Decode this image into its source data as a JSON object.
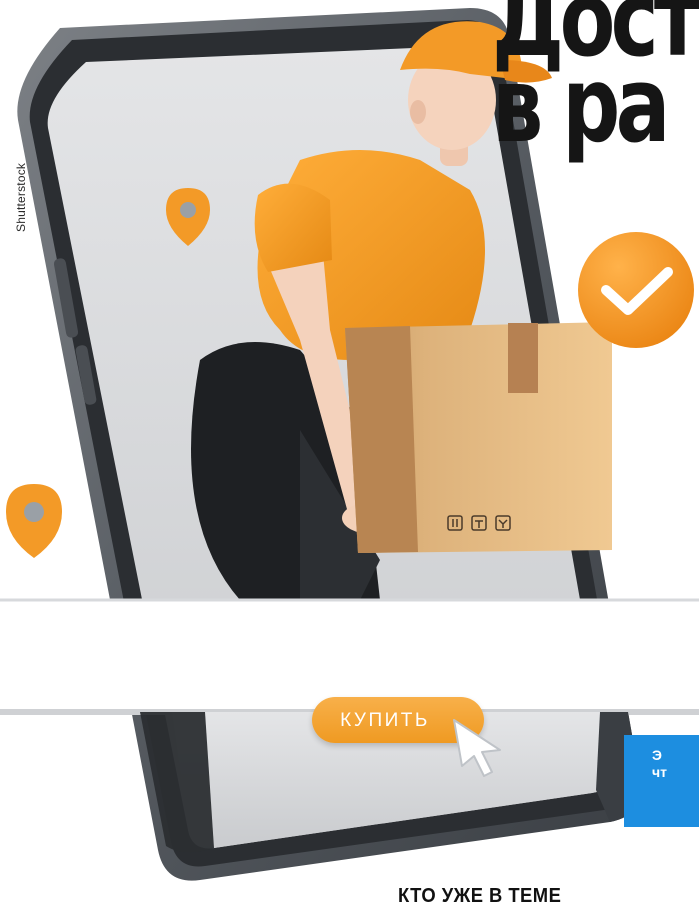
{
  "headline": {
    "line1": "Дост",
    "line2": "в ра"
  },
  "photo_credit": "Shutterstock",
  "buy_button": {
    "label": "КУПИТЬ"
  },
  "info_box": {
    "line1": "Э",
    "line2": "чт"
  },
  "bottom_caption": "КТО УЖЕ В ТЕМЕ",
  "colors": {
    "accent_orange": "#f39a27",
    "info_blue": "#1d8ee0",
    "headline": "#151515"
  },
  "icons": [
    "map-pin-icon",
    "map-pin-icon",
    "checkmark-badge-icon",
    "mouse-cursor-icon",
    "package-symbols-icon"
  ]
}
